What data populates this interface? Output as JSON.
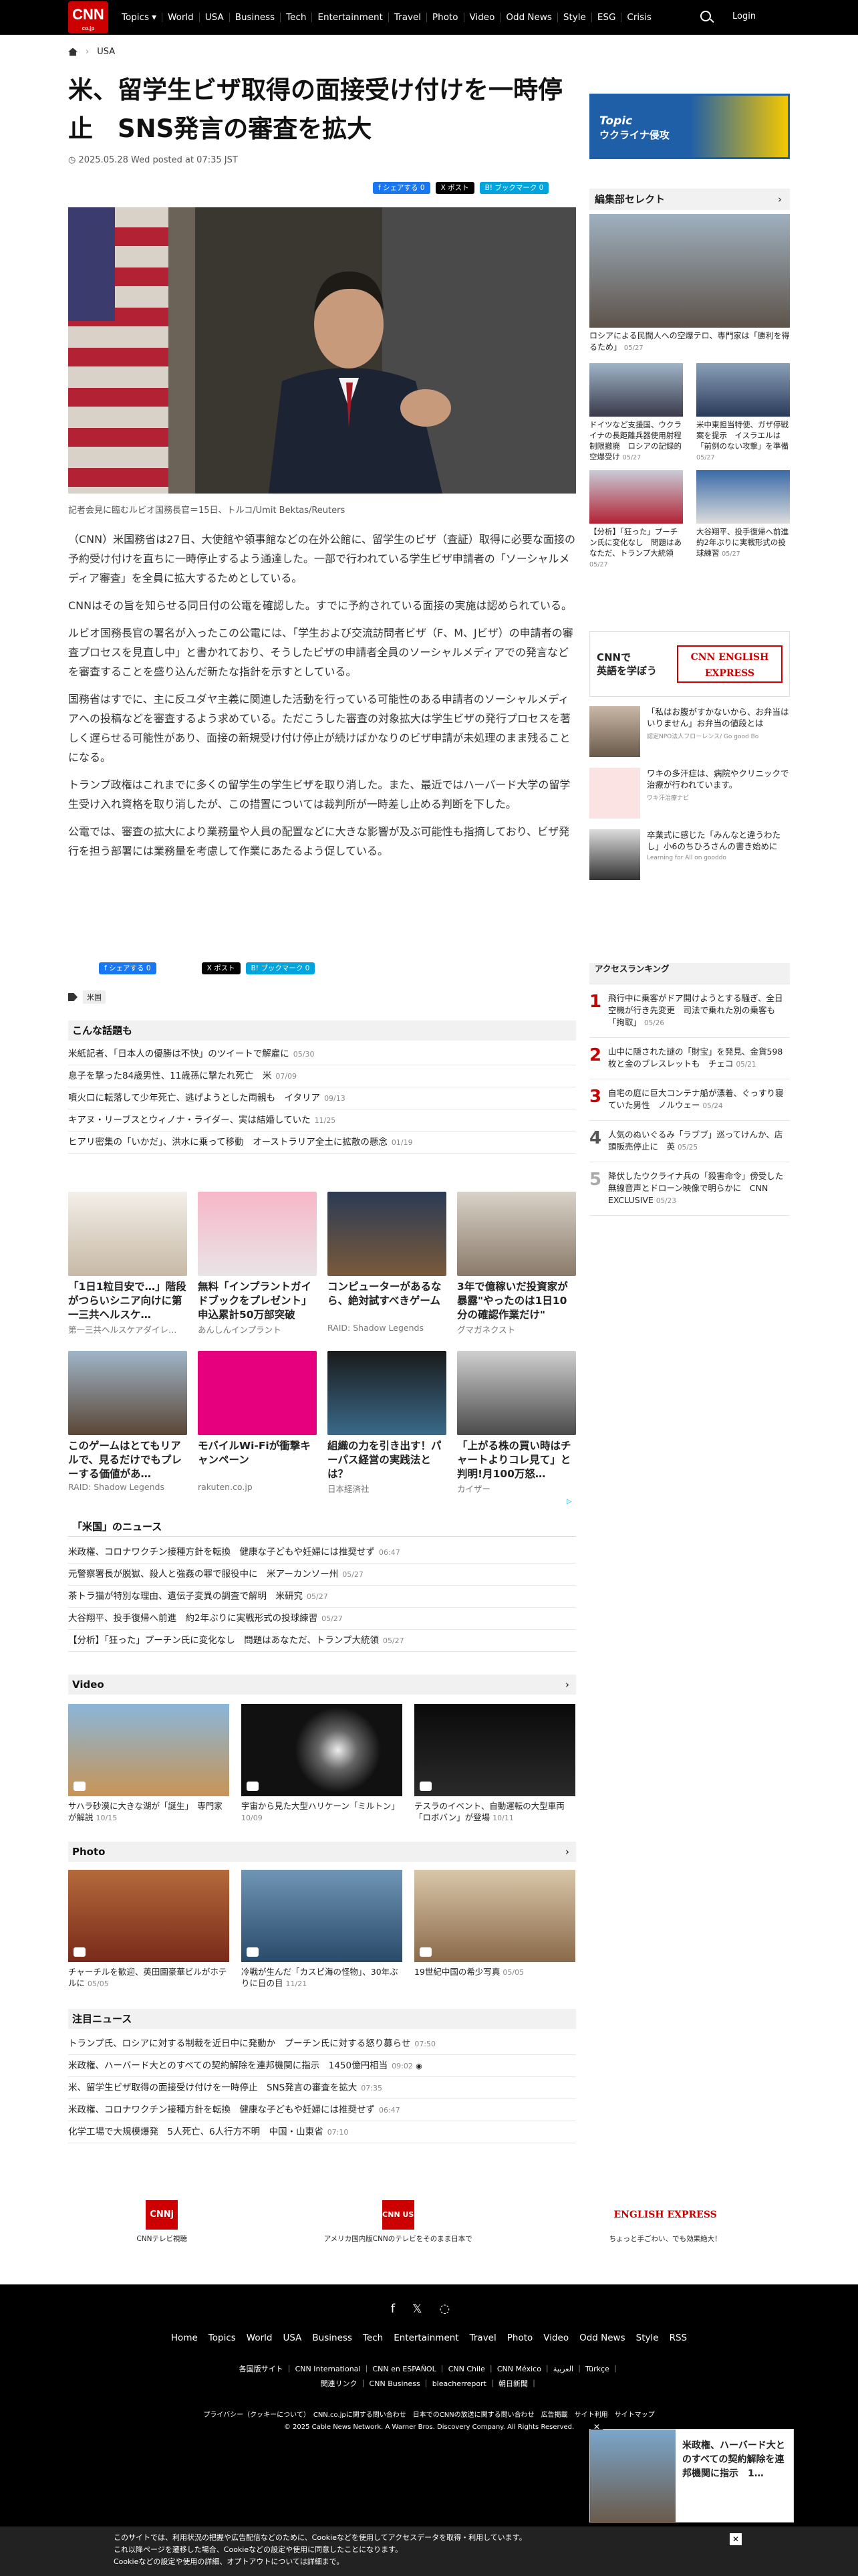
{
  "header": {
    "logo": "CNN",
    "logo_sub": "co.jp",
    "nav": [
      "Topics ▾",
      "World",
      "USA",
      "Business",
      "Tech",
      "Entertainment",
      "Travel",
      "Photo",
      "Video",
      "Odd News",
      "Style",
      "ESG",
      "Crisis"
    ],
    "login": "Login"
  },
  "breadcrumb": {
    "section": "USA"
  },
  "article": {
    "title": "米、留学生ビザ取得の面接受け付けを一時停止　SNS発言の審査を拡大",
    "date": "2025.05.28 Wed posted at 07:35 JST",
    "share": {
      "fb": "f シェアする 0",
      "x": "X ポスト",
      "hb": "B! ブックマーク 0"
    },
    "caption": "記者会見に臨むルビオ国務長官＝15日、トルコ/Umit Bektas/Reuters",
    "paragraphs": [
      "（CNN）米国務省は27日、大使館や領事館などの在外公館に、留学生のビザ（査証）取得に必要な面接の予約受け付けを直ちに一時停止するよう通達した。一部で行われている学生ビザ申請者の「ソーシャルメディア審査」を全員に拡大するためとしている。",
      "CNNはその旨を知らせる同日付の公電を確認した。すでに予約されている面接の実施は認められている。",
      "ルビオ国務長官の署名が入ったこの公電には、「学生および交流訪問者ビザ（F、M、Jビザ）の申請者の審査プロセスを見直し中」と書かれており、そうしたビザの申請者全員のソーシャルメディアでの発言などを審査することを盛り込んだ新たな指針を示すとしている。",
      "国務省はすでに、主に反ユダヤ主義に関連した活動を行っている可能性のある申請者のソーシャルメディアへの投稿などを審査するよう求めている。ただこうした審査の対象拡大は学生ビザの発行プロセスを著しく遅らせる可能性があり、面接の新規受け付け停止が続けばかなりのビザ申請が未処理のまま残ることになる。",
      "トランプ政権はこれまでに多くの留学生の学生ビザを取り消した。また、最近ではハーバード大学の留学生受け入れ資格を取り消したが、この措置については裁判所が一時差し止める判断を下した。",
      "公電では、審査の拡大により業務量や人員の配置などに大きな影響が及ぶ可能性も指摘しており、ビザ発行を担う部署には業務量を考慮して作業にあたるよう促している。"
    ],
    "tag": "米国"
  },
  "related": {
    "title": "こんな話題も",
    "items": [
      {
        "t": "米紙記者、「日本人の優勝は不快」のツイートで解雇に",
        "d": "05/30"
      },
      {
        "t": "息子を撃った84歳男性、11歳孫に撃たれ死亡　米",
        "d": "07/09"
      },
      {
        "t": "噴火口に転落して少年死亡、逃げようとした両親も　イタリア",
        "d": "09/13"
      },
      {
        "t": "キアヌ・リーブスとウィノナ・ライダー、実は結婚していた",
        "d": "11/25"
      },
      {
        "t": "ヒアリ密集の「いかだ」、洪水に乗って移動　オーストラリア全土に拡散の懸念",
        "d": "01/19"
      }
    ]
  },
  "ads": [
    {
      "t": "「1日1粒目安で…」階段がつらいシニア向けに第一三共ヘルスケ…",
      "s": "第一三共ヘルスケアダイレ…"
    },
    {
      "t": "無料「インプラントガイドブックをプレゼント」申込累計50万部突破",
      "s": "あんしんインプラント"
    },
    {
      "t": "コンピューターがあるなら、絶対試すべきゲーム",
      "s": "RAID: Shadow Legends"
    },
    {
      "t": "3年で億稼いだ投資家が暴露\"やったのは1日10分の確認作業だけ\"",
      "s": "グマガネクスト"
    },
    {
      "t": "このゲームはとてもリアルで、見るだけでもプレーする価値があ…",
      "s": "RAID: Shadow Legends"
    },
    {
      "t": "モバイルWi-Fiが衝撃キャンペーン",
      "s": "rakuten.co.jp"
    },
    {
      "t": "組織の力を引き出す！パーパス経営の実践法とは？",
      "s": "日本経済社"
    },
    {
      "t": "「上がる株の買い時はチャートよりコレ見て」と判明!月100万怒…",
      "s": "カイザー"
    }
  ],
  "us_news": {
    "title": "「米国」のニュース",
    "items": [
      {
        "t": "米政権、コロナワクチン接種方針を転換　健康な子どもや妊婦には推奨せず",
        "d": "06:47"
      },
      {
        "t": "元警察署長が脱獄、殺人と強姦の罪で服役中に　米アーカンソー州",
        "d": "05/27"
      },
      {
        "t": "茶トラ猫が特別な理由、遺伝子変異の調査で解明　米研究",
        "d": "05/27"
      },
      {
        "t": "大谷翔平、投手復帰へ前進　約2年ぶりに実戦形式の投球練習",
        "d": "05/27"
      },
      {
        "t": "【分析】「狂った」プーチン氏に変化なし　問題はあなただ、トランプ大統領",
        "d": "05/27"
      }
    ]
  },
  "video": {
    "title": "Video",
    "items": [
      {
        "t": "サハラ砂漠に大きな湖が「誕生」　専門家が解説",
        "d": "10/15"
      },
      {
        "t": "宇宙から見た大型ハリケーン「ミルトン」",
        "d": "10/09"
      },
      {
        "t": "テスラのイベント、自動運転の大型車両「ロボバン」が登場",
        "d": "10/11"
      }
    ]
  },
  "photo": {
    "title": "Photo",
    "items": [
      {
        "t": "チャーチルを歓迎、英田園豪華ビルがホテルに",
        "d": "05/05"
      },
      {
        "t": "冷戦が生んだ「カスピ海の怪物」、30年ぶりに日の目",
        "d": "11/21"
      },
      {
        "t": "19世紀中国の希少写真",
        "d": "05/05"
      }
    ]
  },
  "featured": {
    "title": "注目ニュース",
    "items": [
      {
        "t": "トランプ氏、ロシアに対する制裁を近日中に発動か　プーチン氏に対する怒り募らせ",
        "d": "07:50"
      },
      {
        "t": "米政権、ハーバード大とのすべての契約解除を連邦機関に指示　1450億円相当",
        "d": "09:02"
      },
      {
        "t": "米、留学生ビザ取得の面接受け付けを一時停止　SNS発言の審査を拡大",
        "d": "07:35"
      },
      {
        "t": "米政権、コロナワクチン接種方針を転換　健康な子どもや妊婦には推奨せず",
        "d": "06:47"
      },
      {
        "t": "化学工場で大規模爆発　5人死亡、6人行方不明　中国・山東省",
        "d": "07:10"
      }
    ]
  },
  "promos": [
    {
      "label": "CNNテレビ視聴",
      "logo": "CNNj"
    },
    {
      "label": "アメリカ国内版CNNのテレビをそのまま日本で",
      "logo": "CNN US"
    },
    {
      "label": "ちょっと手ごわい、でも効果絶大！",
      "logo": "ENGLISH EXPRESS"
    }
  ],
  "sidebar": {
    "topic_label": "Topic",
    "topic_title": "ウクライナ侵攻",
    "editor_title": "編集部セレクト",
    "editor_main": {
      "t": "ロシアによる民間人への空爆テロ、専門家は「勝利を得るため」",
      "d": "05/27"
    },
    "editor_pairs": [
      {
        "t": "ドイツなど支援国、ウクライナの長距離兵器使用射程制限撤廃　ロシアの記録的空爆受け",
        "d": "05/27"
      },
      {
        "t": "米中東担当特使、ガザ停戦案を提示　イスラエルは「前例のない攻撃」を準備",
        "d": "05/27"
      },
      {
        "t": "【分析】「狂った」プーチン氏に変化なし　問題はあなただ、トランプ大統領",
        "d": "05/27"
      },
      {
        "t": "大谷翔平、投手復帰へ前進　約2年ぶりに実戦形式の投球練習",
        "d": "05/27"
      }
    ],
    "ee_banner": {
      "line1": "CNNで",
      "line2": "英語を学ぼう",
      "logo": "CNN ENGLISH EXPRESS"
    },
    "sponsored": [
      {
        "t": "「私はお腹がすかないから、お弁当はいりません」お弁当の値段とは",
        "s": "認定NPO法人フローレンス/ Go good Bo"
      },
      {
        "t": "ワキの多汗症は、病院やクリニックで治療が行われています。",
        "s": "ワキ汗治療ナビ"
      },
      {
        "t": "卒業式に感じた「みんなと違うわたし」小6のちひろさんの書き始めに",
        "s": "Learning for All on gooddo"
      }
    ],
    "ranking_title": "アクセスランキング",
    "ranking": [
      {
        "n": "1",
        "t": "飛行中に乗客がドア開けようとする騒ぎ、全日空機が行き先変更　司法で乗れた別の乗客も「拘取」",
        "d": "05/26"
      },
      {
        "n": "2",
        "t": "山中に隠された謎の「財宝」を発見、金貨598枚と金のブレスレットも　チェコ",
        "d": "05/21"
      },
      {
        "n": "3",
        "t": "自宅の庭に巨大コンテナ船が漂着、ぐっすり寝ていた男性　ノルウェー",
        "d": "05/24"
      },
      {
        "n": "4",
        "t": "人気のぬいぐるみ「ラブブ」巡ってけんか、店頭販売停止に　英",
        "d": "05/25"
      },
      {
        "n": "5",
        "t": "降伏したウクライナ兵の「殺害命令」傍受した無線音声とドローン映像で明らかに　CNN EXCLUSIVE",
        "d": "05/23"
      }
    ]
  },
  "footer": {
    "nav": [
      "Home",
      "Topics",
      "World",
      "USA",
      "Business",
      "Tech",
      "Entertainment",
      "Travel",
      "Photo",
      "Video",
      "Odd News",
      "Style",
      "RSS"
    ],
    "links1": "各国版サイト ｜ CNN International ｜ CNN en ESPAÑOL ｜ CNN Chile ｜ CNN México ｜ العربية ｜ Türkçe ｜",
    "links2": "関連リンク ｜ CNN Business ｜ bleacherreport ｜ 朝日新聞 ｜",
    "links3": "プライバシー（クッキーについて）　CNN.co.jpに関する問い合わせ　日本でのCNNの放送に関する問い合わせ　広告掲載　サイト利用　サイトマップ",
    "copyright": "© 2025 Cable News Network. A Warner Bros. Discovery Company. All Rights Reserved."
  },
  "cookie": {
    "line1": "このサイトでは、利用状況の把握や広告配信などのために、Cookieなどを使用してアクセスデータを取得・利用しています。",
    "line2": "これ以降ページを遷移した場合、Cookieなどの設定や使用に同意したことになります。",
    "line3": "Cookieなどの設定や使用の詳細、オプトアウトについては詳細まで。"
  },
  "popup": {
    "t": "米政権、ハーバード大とのすべての契約解除を連邦機関に指示　1…"
  }
}
